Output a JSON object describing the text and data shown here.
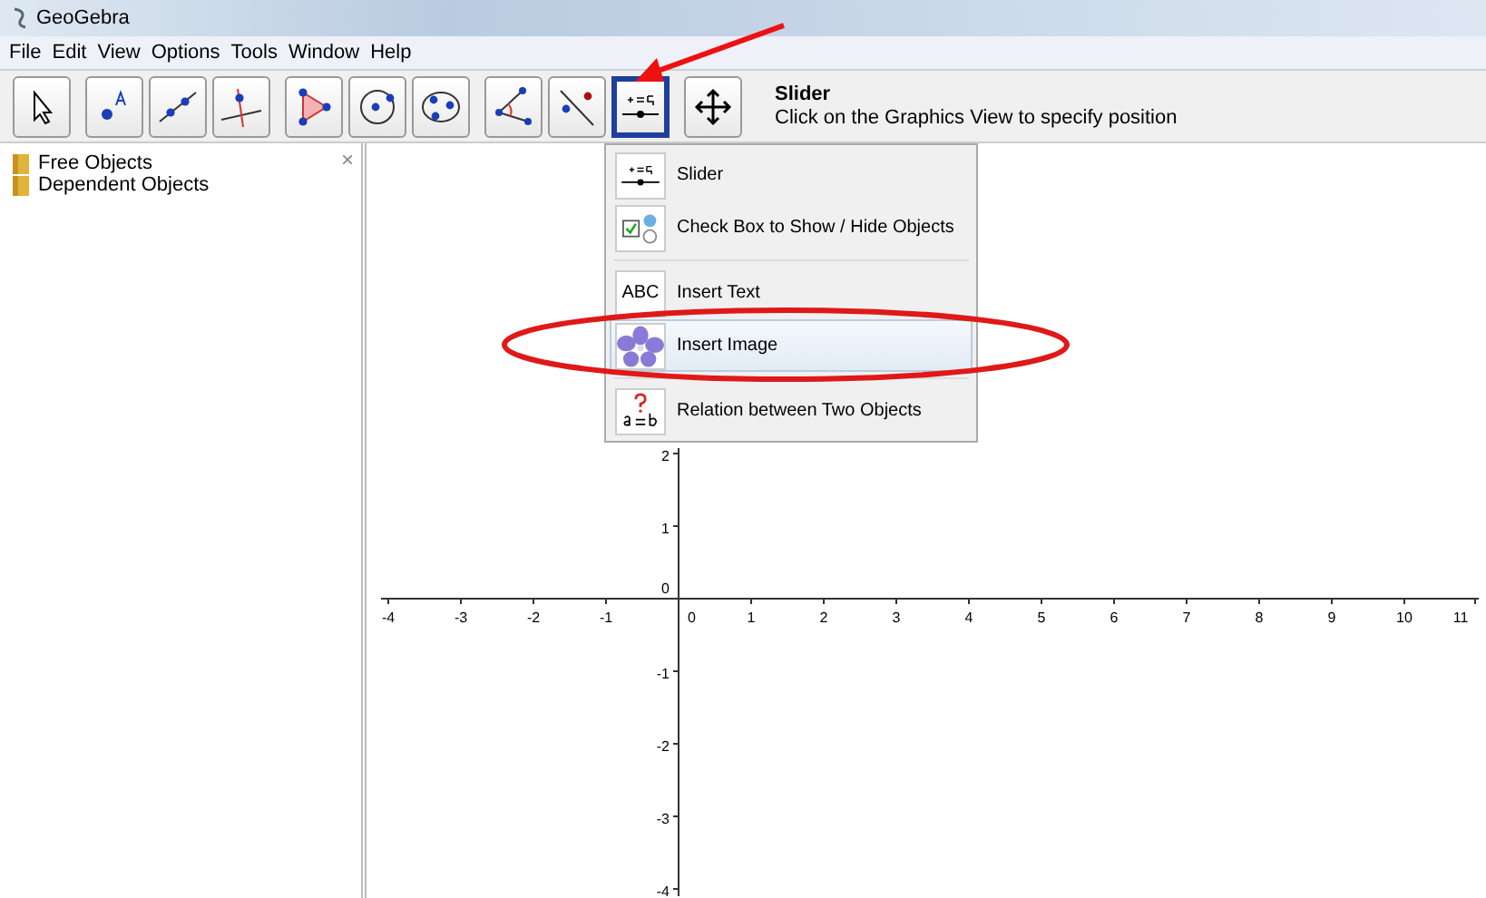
{
  "window": {
    "title": "GeoGebra"
  },
  "menu": [
    "File",
    "Edit",
    "View",
    "Options",
    "Tools",
    "Window",
    "Help"
  ],
  "tool_groups": [
    [
      {
        "kind": "pointer",
        "selected": false
      }
    ],
    [
      {
        "kind": "point",
        "selected": false
      },
      {
        "kind": "line",
        "selected": false
      },
      {
        "kind": "perpendicular",
        "selected": false
      }
    ],
    [
      {
        "kind": "polygon",
        "selected": false
      },
      {
        "kind": "circle",
        "selected": false
      },
      {
        "kind": "conic",
        "selected": false
      }
    ],
    [
      {
        "kind": "angle",
        "selected": false
      },
      {
        "kind": "reflect",
        "selected": false
      },
      {
        "kind": "slider",
        "selected": true
      }
    ],
    [
      {
        "kind": "move",
        "selected": false
      }
    ]
  ],
  "tool_help": {
    "name": "Slider",
    "hint": "Click on the Graphics View to specify position"
  },
  "algebra": {
    "items": [
      "Free Objects",
      "Dependent Objects"
    ],
    "close": "×"
  },
  "dropdown_groups": [
    [
      {
        "kind": "slider",
        "label": "Slider",
        "selected": false
      },
      {
        "kind": "checkbox",
        "label": "Check Box to Show / Hide Objects",
        "selected": false
      }
    ],
    [
      {
        "kind": "text",
        "label": "Insert Text",
        "icon_text": "ABC",
        "selected": false
      },
      {
        "kind": "image",
        "label": "Insert Image",
        "selected": true
      }
    ],
    [
      {
        "kind": "relation",
        "label": "Relation between Two Objects",
        "selected": false
      }
    ]
  ],
  "graphics": {
    "x_labels": [
      "-4",
      "-3",
      "-2",
      "-1",
      "0",
      "1",
      "2",
      "3",
      "4",
      "5",
      "6",
      "7",
      "8",
      "9",
      "10",
      "11"
    ],
    "y_labels": [
      "2",
      "1",
      "0",
      "-1",
      "-2",
      "-3",
      "-4"
    ]
  }
}
